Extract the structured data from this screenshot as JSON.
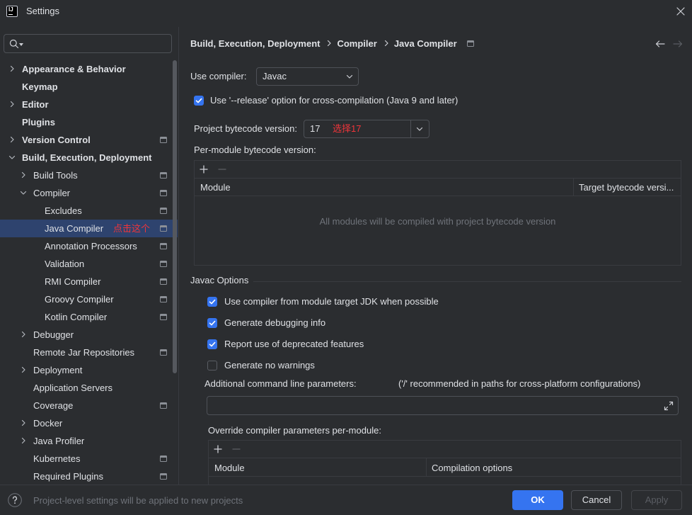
{
  "window": {
    "title": "Settings",
    "app_icon": "intellij-app-icon",
    "app_icon_text": "IJ",
    "close_icon": "close-icon"
  },
  "search": {
    "value": "",
    "icon": "search-icon"
  },
  "tree": {
    "items": [
      {
        "label": "Appearance & Behavior",
        "expandable": true,
        "expanded": false
      },
      {
        "label": "Keymap"
      },
      {
        "label": "Editor",
        "expandable": true,
        "expanded": false
      },
      {
        "label": "Plugins"
      },
      {
        "label": "Version Control",
        "expandable": true,
        "expanded": false,
        "icon": "project-scope-icon"
      },
      {
        "label": "Build, Execution, Deployment",
        "expandable": true,
        "expanded": true
      },
      {
        "label": "Build Tools",
        "expandable": true,
        "expanded": false,
        "icon": "project-scope-icon"
      },
      {
        "label": "Compiler",
        "expandable": true,
        "expanded": true,
        "icon": "project-scope-icon"
      },
      {
        "label": "Excludes",
        "icon": "project-scope-icon"
      },
      {
        "label": "Java Compiler",
        "selected": true,
        "icon": "project-scope-icon",
        "annotation": "点击这个"
      },
      {
        "label": "Annotation Processors",
        "icon": "project-scope-icon"
      },
      {
        "label": "Validation",
        "icon": "project-scope-icon"
      },
      {
        "label": "RMI Compiler",
        "icon": "project-scope-icon"
      },
      {
        "label": "Groovy Compiler",
        "icon": "project-scope-icon"
      },
      {
        "label": "Kotlin Compiler",
        "icon": "project-scope-icon"
      },
      {
        "label": "Debugger",
        "expandable": true,
        "expanded": false
      },
      {
        "label": "Remote Jar Repositories",
        "icon": "project-scope-icon"
      },
      {
        "label": "Deployment",
        "expandable": true,
        "expanded": false
      },
      {
        "label": "Application Servers"
      },
      {
        "label": "Coverage",
        "icon": "project-scope-icon"
      },
      {
        "label": "Docker",
        "expandable": true,
        "expanded": false
      },
      {
        "label": "Java Profiler",
        "expandable": true,
        "expanded": false
      },
      {
        "label": "Kubernetes",
        "icon": "project-scope-icon"
      },
      {
        "label": "Required Plugins",
        "icon": "project-scope-icon"
      }
    ]
  },
  "breadcrumb": {
    "items": [
      "Build, Execution, Deployment",
      "Compiler",
      "Java Compiler"
    ]
  },
  "compiler": {
    "label": "Use compiler:",
    "value": "Javac"
  },
  "release_option": {
    "label": "Use '--release' option for cross-compilation (Java 9 and later)",
    "checked": true
  },
  "bytecode": {
    "label": "Project bytecode version:",
    "value": "17",
    "annotation": "选择17"
  },
  "per_module": {
    "label": "Per-module bytecode version:",
    "columns": [
      "Module",
      "Target bytecode versi..."
    ],
    "empty_text": "All modules will be compiled with project bytecode version"
  },
  "javac_options": {
    "title": "Javac Options",
    "options": [
      {
        "label": "Use compiler from module target JDK when possible",
        "checked": true
      },
      {
        "label": "Generate debugging info",
        "checked": true
      },
      {
        "label": "Report use of deprecated features",
        "checked": true
      },
      {
        "label": "Generate no warnings",
        "checked": false
      }
    ]
  },
  "additional": {
    "label": "Additional command line parameters:",
    "hint": "('/' recommended in paths for cross-platform configurations)",
    "value": ""
  },
  "override": {
    "label": "Override compiler parameters per-module:",
    "columns": [
      "Module",
      "Compilation options"
    ]
  },
  "footer": {
    "hint": "Project-level settings will be applied to new projects",
    "ok": "OK",
    "cancel": "Cancel",
    "apply": "Apply",
    "apply_enabled": false
  },
  "colors": {
    "background": "#2B2D30",
    "accent": "#3574F0",
    "selection": "#2E436E",
    "annotation": "#F0353A",
    "text": "#DFE1E5",
    "muted": "#6F737A"
  }
}
